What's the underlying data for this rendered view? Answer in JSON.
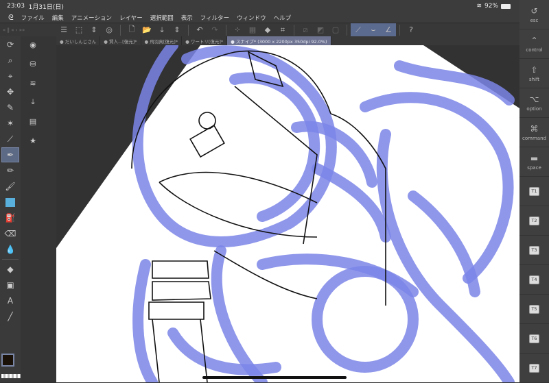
{
  "status": {
    "time": "23:03",
    "date": "1月31日(日)",
    "battery": "92%"
  },
  "menu": [
    "ファイル",
    "編集",
    "アニメーション",
    "レイヤー",
    "選択範囲",
    "表示",
    "フィルター",
    "ウィンドウ",
    "ヘルプ"
  ],
  "tabs": [
    "● だいしんじさん",
    "● 賢人...[復元]*",
    "● 飛羽真[復元]*",
    "● ワートリ[復元]*",
    "● スナイプ* (3000 x 2200px 350dpi 92.0%)"
  ],
  "modifier_keys": [
    {
      "icon": "↺",
      "label": "esc"
    },
    {
      "icon": "⌃",
      "label": "control"
    },
    {
      "icon": "⇧",
      "label": "shift"
    },
    {
      "icon": "⌥",
      "label": "option"
    },
    {
      "icon": "⌘",
      "label": "command"
    },
    {
      "icon": "▬",
      "label": "space"
    }
  ],
  "custom_keys": [
    "T1",
    "T2",
    "T3",
    "T4",
    "T5",
    "T6",
    "T7"
  ],
  "colors": {
    "main": "#1a1208",
    "sub": "#fdf6a0",
    "accent": "#5b6a8f",
    "stroke": "#7b85e8"
  }
}
